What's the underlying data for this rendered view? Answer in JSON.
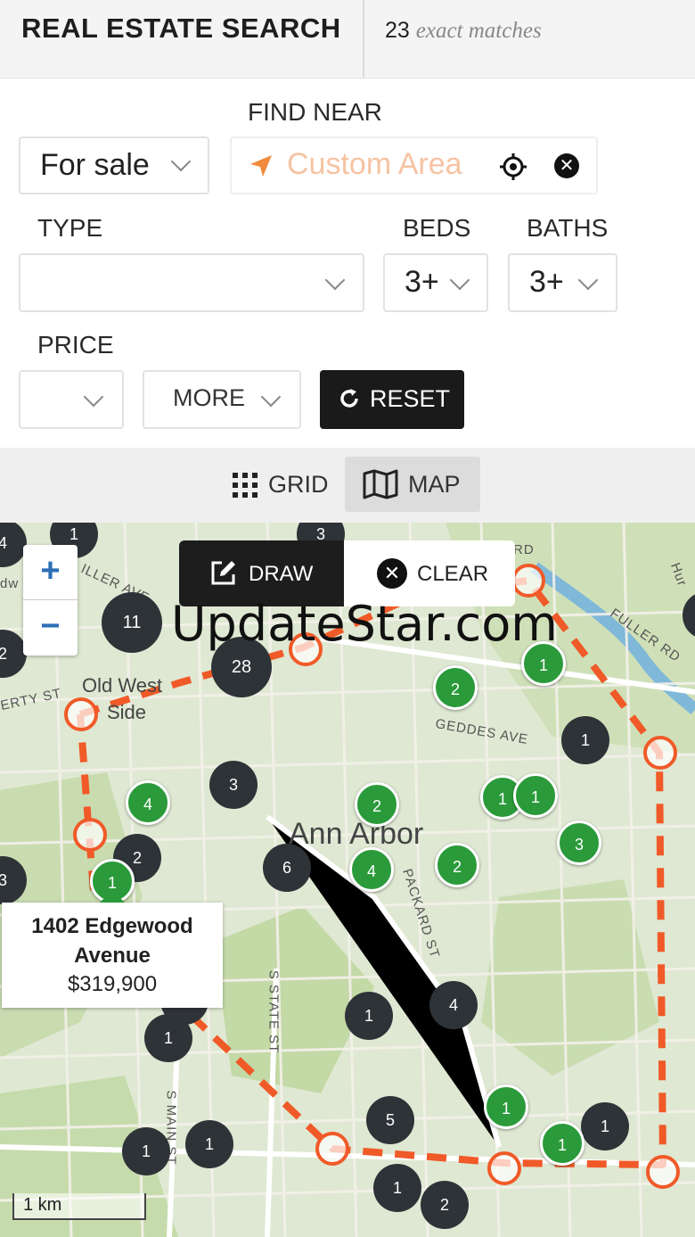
{
  "header": {
    "title": "REAL ESTATE SEARCH",
    "match_count": "23",
    "match_text": "exact matches"
  },
  "filters": {
    "listing_type": "For sale",
    "find_near_label": "FIND NEAR",
    "find_near_placeholder": "Custom Area",
    "type_label": "TYPE",
    "type_value": "",
    "beds_label": "BEDS",
    "beds_value": "3+",
    "baths_label": "BATHS",
    "baths_value": "3+",
    "price_label": "PRICE",
    "price_value": "",
    "more_label": "MORE",
    "reset_label": "RESET"
  },
  "view_toggle": {
    "grid_label": "GRID",
    "map_label": "MAP",
    "active": "map"
  },
  "map": {
    "zoom_in": "+",
    "zoom_out": "−",
    "draw_label": "DRAW",
    "clear_label": "CLEAR",
    "watermark": "UpdateStar.com",
    "city_label": "Ann Arbor",
    "area_label_1": "Old West",
    "area_label_2": "Side",
    "streets": {
      "fuller": "FULLER RD",
      "geddes": "GEDDES AVE",
      "packard": "PACKARD ST",
      "state": "S STATE ST",
      "main": "S MAIN ST",
      "liberty": "ERTY ST",
      "miller": "ILLER AVE",
      "rd": "RD",
      "hur": "Hur",
      "dw": "dw"
    },
    "scale_label": "1 km",
    "markers_dark": [
      "4",
      "1",
      "3",
      "11",
      "28",
      "1",
      "3",
      "2",
      "6",
      "3",
      "2",
      "1",
      "4",
      "1",
      "5",
      "1",
      "1",
      "1",
      "2",
      "1",
      "1",
      "2"
    ],
    "markers_green": [
      "2",
      "1",
      "2",
      "4",
      "1",
      "1",
      "3",
      "4",
      "2",
      "1",
      "1",
      "1"
    ],
    "tooltip": {
      "address": "1402 Edgewood Avenue",
      "price": "$319,900"
    },
    "colors": {
      "dark_marker": "#2e3338",
      "green_marker": "#2a9a3a",
      "draw_line": "#f05a28"
    }
  }
}
